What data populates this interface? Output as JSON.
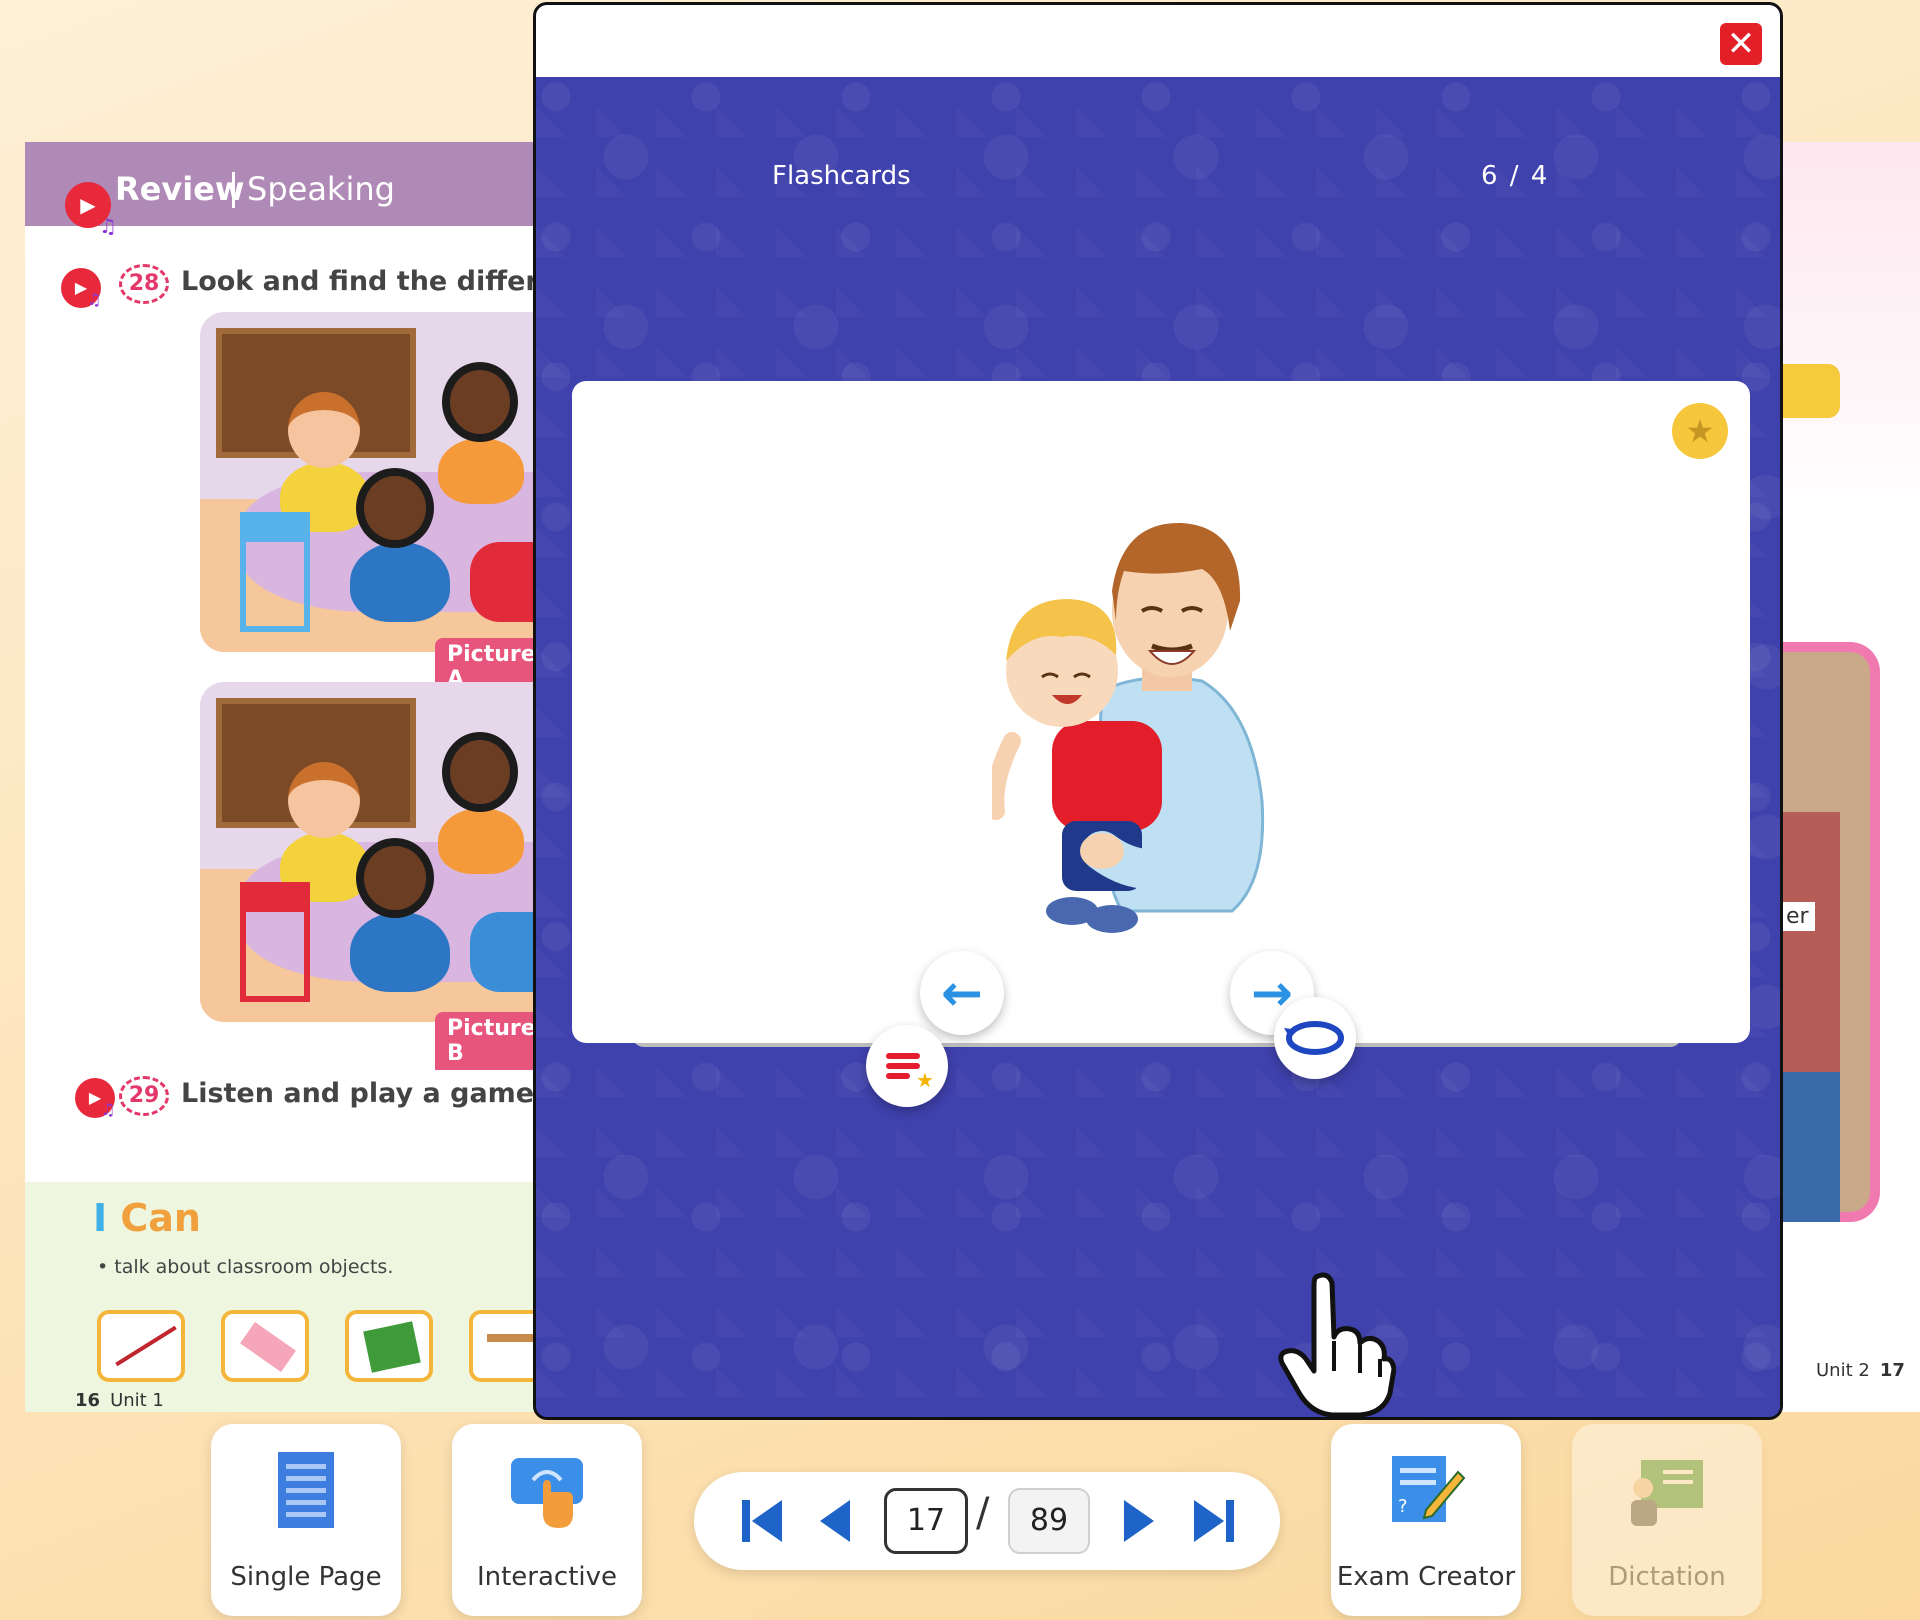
{
  "left_page": {
    "header_review": "Review",
    "header_speaking": "Speaking",
    "ex28_number": "28",
    "ex28_text": "Look and find the differe",
    "picture_a": "Picture A",
    "picture_b": "Picture B",
    "ex29_number": "29",
    "ex29_text": "Listen and play a game.",
    "ican_i": "I",
    "ican_can": "Can",
    "ican_bullet": "•  talk about classroom objects.",
    "page_number": "16",
    "unit_label": "Unit 1"
  },
  "right_page": {
    "partial_text": "er",
    "unit_label": "Unit 2",
    "page_number": "17"
  },
  "modal": {
    "close_glyph": "✕",
    "title": "Flashcards",
    "counter": "6 / 4",
    "star_glyph": "★",
    "prev_glyph": "←",
    "next_glyph": "→"
  },
  "toolbar": {
    "single_page_label": "Single Page",
    "interactive_label": "Interactive",
    "exam_creator_label": "Exam Creator",
    "dictation_label": "Dictation",
    "current_page": "17",
    "slash": "/",
    "total_pages": "89"
  },
  "colors": {
    "modal_bg": "#3f41ac",
    "accent_blue": "#1e63c8",
    "close_red": "#e32027",
    "star_yellow": "#f6c63c"
  }
}
